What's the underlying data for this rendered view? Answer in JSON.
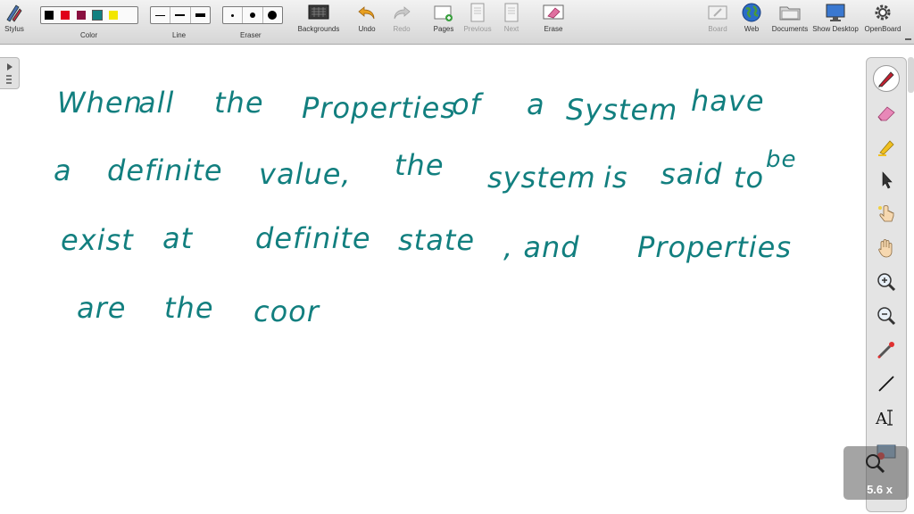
{
  "toolbar": {
    "stylus": "Stylus",
    "color": "Color",
    "line": "Line",
    "eraser": "Eraser",
    "backgrounds": "Backgrounds",
    "undo": "Undo",
    "redo": "Redo",
    "pages": "Pages",
    "previous": "Previous",
    "next": "Next",
    "erase": "Erase",
    "board": "Board",
    "web": "Web",
    "documents": "Documents",
    "show_desktop": "Show Desktop",
    "openboard": "OpenBoard",
    "colors": [
      "#000000",
      "#e0001a",
      "#8a1040",
      "#128080",
      "#f2e600"
    ]
  },
  "handwriting": {
    "line1": [
      "When",
      "all",
      "the",
      "Properties",
      "of",
      "a",
      "System",
      "have"
    ],
    "line2": [
      "a",
      "definite",
      "value,",
      "the",
      "system",
      "is",
      "said",
      "to",
      "be"
    ],
    "line3": [
      "exist",
      "at",
      "definite",
      "state",
      ", and",
      "Properties"
    ],
    "line4": [
      "are",
      "the",
      "coor"
    ]
  },
  "zoom": {
    "label": "5.6 x"
  },
  "ink_color": "#127f7f"
}
